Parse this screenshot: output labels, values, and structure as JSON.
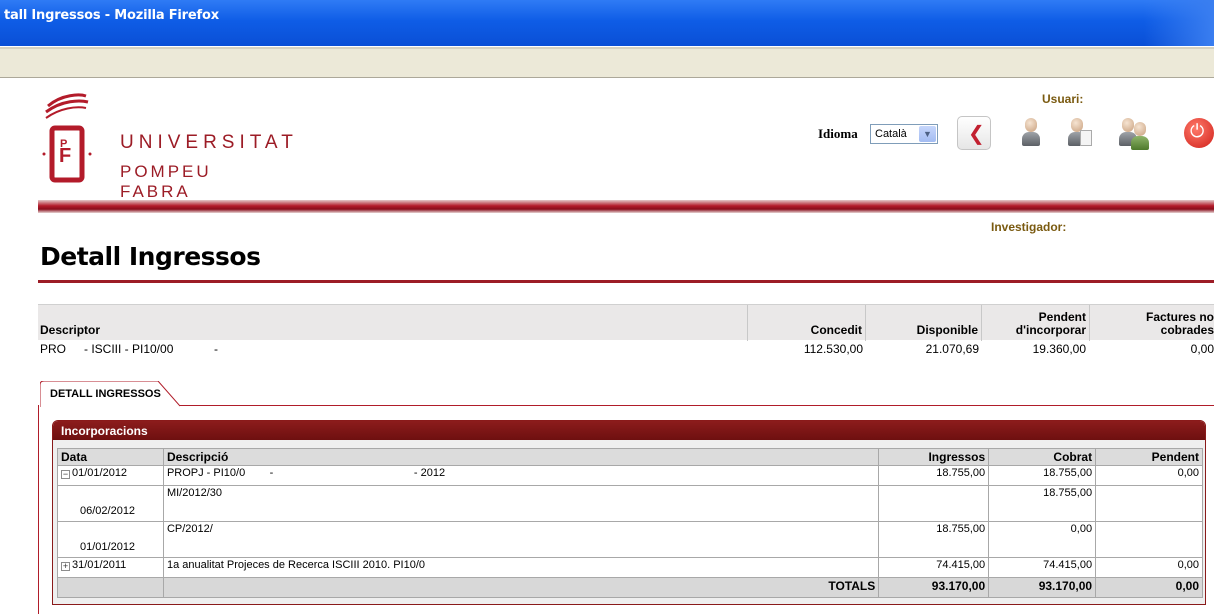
{
  "window": {
    "title": "tall Ingressos - Mozilla Firefox"
  },
  "header": {
    "logo": {
      "line1": "UNIVERSITAT",
      "line2": "POMPEU FABRA"
    },
    "usuari_label": "Usuari:",
    "idioma_label": "Idioma",
    "language_select": {
      "selected": "Català"
    },
    "investigador_label": "Investigador:"
  },
  "page": {
    "title": "Detall Ingressos"
  },
  "descriptor": {
    "headers": {
      "descriptor": "Descriptor",
      "concedit": "Concedit",
      "disponible": "Disponible",
      "pendent": "Pendent d'incorporar",
      "factures": "Factures no cobrades"
    },
    "row": {
      "code": "PRO",
      "desc": "- ISCIII - PI10/00",
      "dash": "-",
      "concedit": "112.530,00",
      "disponible": "21.070,69",
      "pendent": "19.360,00",
      "factures": "0,00"
    }
  },
  "tabs": [
    {
      "label": "DETALL INGRESSOS"
    }
  ],
  "incorporacions": {
    "title": "Incorporacions",
    "headers": {
      "data": "Data",
      "descripcio": "Descripció",
      "ingressos": "Ingressos",
      "cobrat": "Cobrat",
      "pendent": "Pendent"
    },
    "rows": [
      {
        "expander": "−",
        "data": "01/01/2012",
        "descripcio": "PROPJ - PI10/0        -                                              - 2012",
        "ingressos": "18.755,00",
        "cobrat": "18.755,00",
        "pendent": "0,00"
      },
      {
        "expander": "",
        "data": "06/02/2012",
        "descripcio": "MI/2012/30",
        "ingressos": "",
        "cobrat": "18.755,00",
        "pendent": ""
      },
      {
        "expander": "",
        "data": "01/01/2012",
        "descripcio": "CP/2012/",
        "ingressos": "18.755,00",
        "cobrat": "0,00",
        "pendent": ""
      },
      {
        "expander": "+",
        "data": "31/01/2011",
        "descripcio": "1a anualitat Projeces de Recerca ISCIII 2010. PI10/0",
        "ingressos": "74.415,00",
        "cobrat": "74.415,00",
        "pendent": "0,00"
      }
    ],
    "totals": {
      "label": "TOTALS",
      "ingressos": "93.170,00",
      "cobrat": "93.170,00",
      "pendent": "0,00"
    }
  }
}
